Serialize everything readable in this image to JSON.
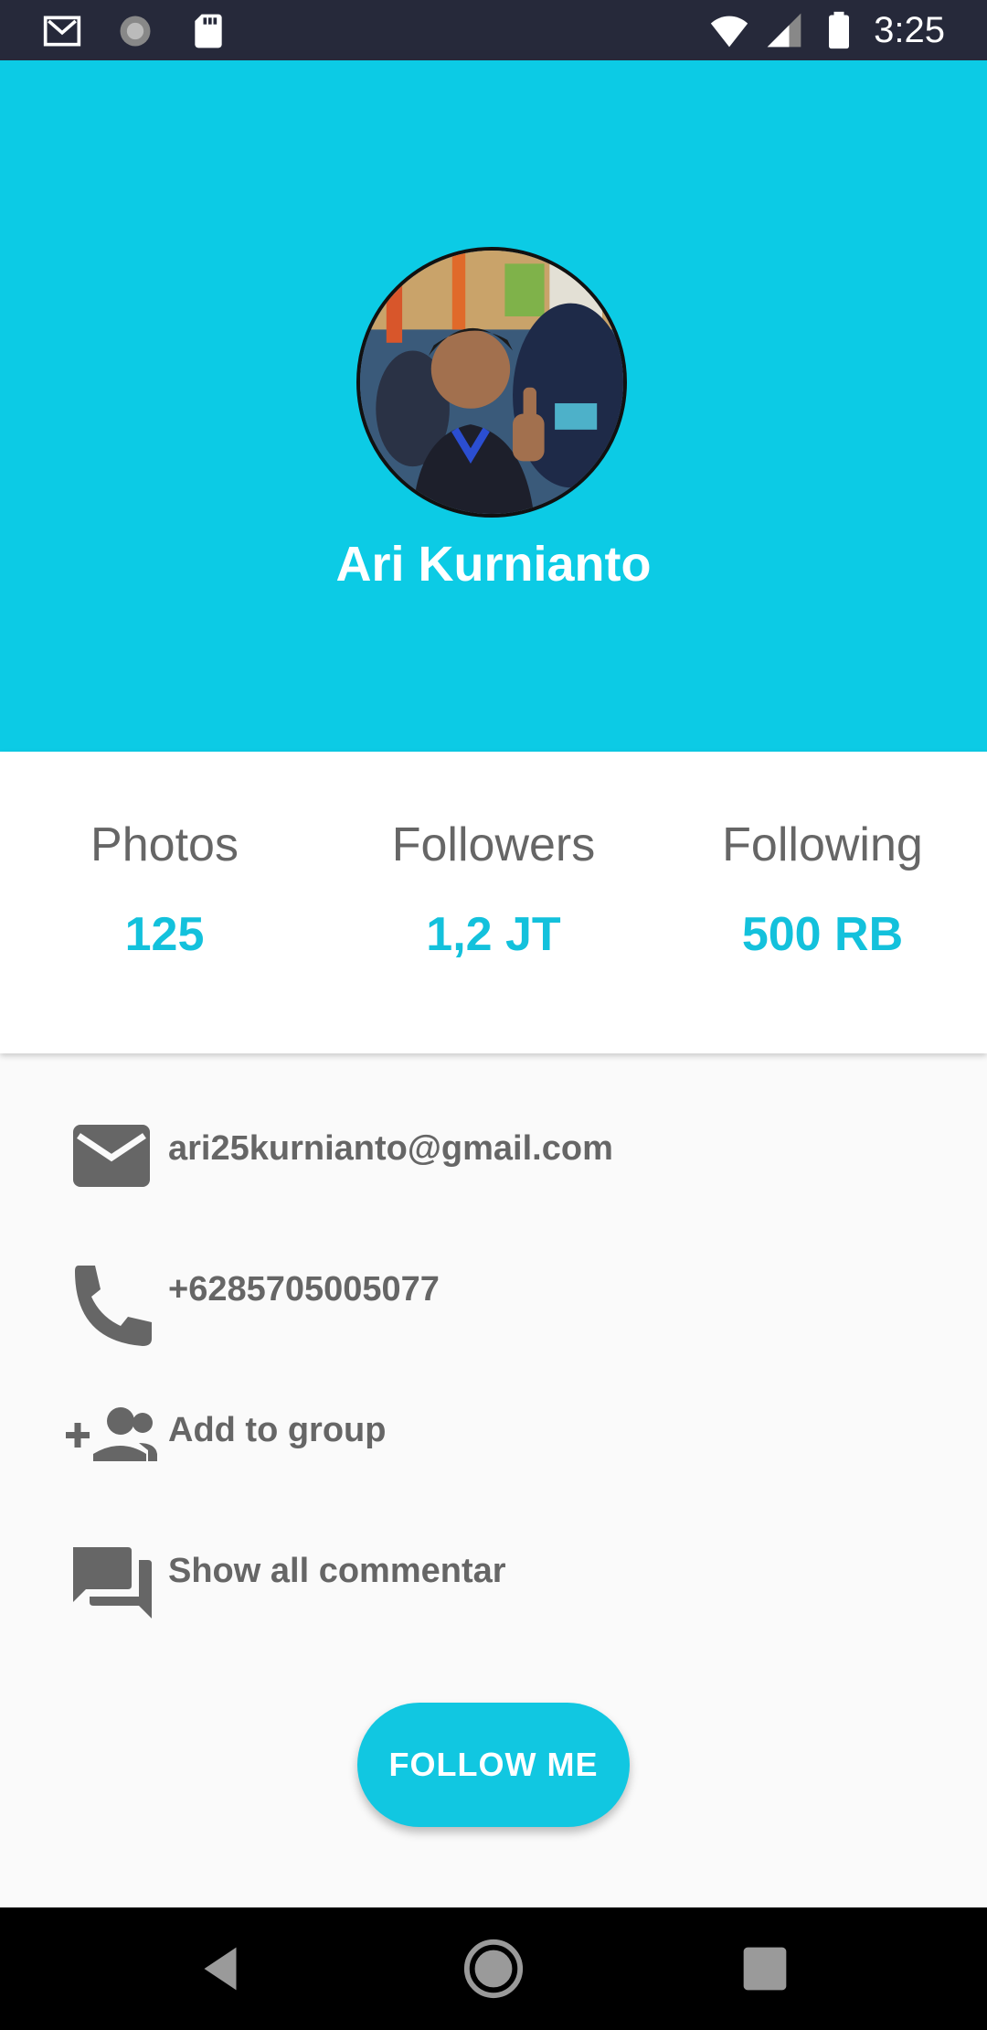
{
  "status_bar": {
    "time": "3:25",
    "icons_left": [
      "gmail-icon",
      "sync-icon",
      "sd-card-icon"
    ],
    "icons_right": [
      "wifi-icon",
      "signal-icon",
      "battery-icon"
    ]
  },
  "profile": {
    "name": "Ari Kurnianto",
    "avatar": "profile-photo"
  },
  "stats": [
    {
      "label": "Photos",
      "value": "125"
    },
    {
      "label": "Followers",
      "value": "1,2 JT"
    },
    {
      "label": "Following",
      "value": "500 RB"
    }
  ],
  "info": {
    "email": "ari25kurnianto@gmail.com",
    "phone": "+6285705005077",
    "add_group": "Add to group",
    "comments": "Show all commentar"
  },
  "follow_button": "FOLLOW ME",
  "colors": {
    "accent": "#0ccbe5",
    "stat_value": "#13c1dc",
    "text_gray": "#666666",
    "status_bar": "#26293a"
  },
  "nav": [
    "back-icon",
    "home-icon",
    "recents-icon"
  ]
}
